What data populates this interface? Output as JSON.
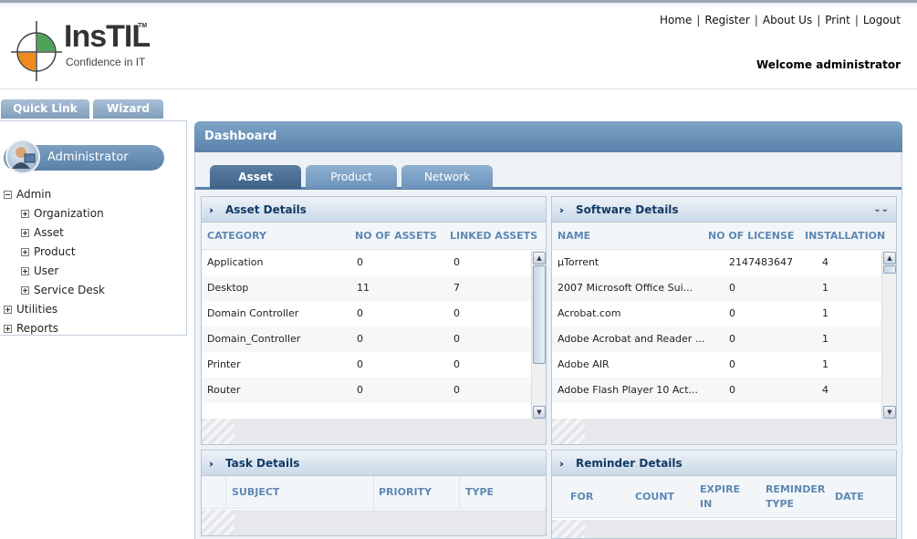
{
  "header": {
    "logo_title": "InsTIL",
    "logo_tm": "TM",
    "logo_tagline": "Confidence in IT",
    "nav": [
      "Home",
      "Register",
      "About Us",
      "Print",
      "Logout"
    ],
    "welcome": "Welcome administrator"
  },
  "quick_tabs": [
    "Quick Link",
    "Wizard"
  ],
  "sidebar": {
    "user_role": "Administrator",
    "tree": {
      "admin": "Admin",
      "organization": "Organization",
      "asset": "Asset",
      "product": "Product",
      "user": "User",
      "service_desk": "Service Desk",
      "utilities": "Utilities",
      "reports": "Reports"
    }
  },
  "dashboard": {
    "title": "Dashboard",
    "tabs": [
      "Asset",
      "Product",
      "Network"
    ],
    "asset_details": {
      "title": "Asset Details",
      "columns": [
        "CATEGORY",
        "NO OF ASSETS",
        "LINKED ASSETS"
      ],
      "rows": [
        [
          "Application",
          "0",
          "0"
        ],
        [
          "Desktop",
          "11",
          "7"
        ],
        [
          "Domain Controller",
          "0",
          "0"
        ],
        [
          "Domain_Controller",
          "0",
          "0"
        ],
        [
          "Printer",
          "0",
          "0"
        ],
        [
          "Router",
          "0",
          "0"
        ]
      ]
    },
    "software_details": {
      "title": "Software Details",
      "columns": [
        "NAME",
        "NO OF LICENSE",
        "INSTALLATION"
      ],
      "rows": [
        [
          "µTorrent",
          "2147483647",
          "4"
        ],
        [
          "2007 Microsoft Office Sui...",
          "0",
          "1"
        ],
        [
          "Acrobat.com",
          "0",
          "1"
        ],
        [
          "Adobe Acrobat and Reader ...",
          "0",
          "1"
        ],
        [
          "Adobe AIR",
          "0",
          "1"
        ],
        [
          "Adobe Flash Player 10 Act...",
          "0",
          "4"
        ]
      ]
    },
    "task_details": {
      "title": "Task Details",
      "columns": [
        "SUBJECT",
        "PRIORITY",
        "TYPE"
      ]
    },
    "reminder_details": {
      "title": "Reminder Details",
      "columns": [
        "FOR",
        "COUNT",
        "EXPIRE IN",
        "REMINDER TYPE",
        "DATE"
      ]
    }
  },
  "colors": {
    "accent": "#5b82aa",
    "header_text": "#123a66",
    "column_text": "#5d88b3"
  }
}
